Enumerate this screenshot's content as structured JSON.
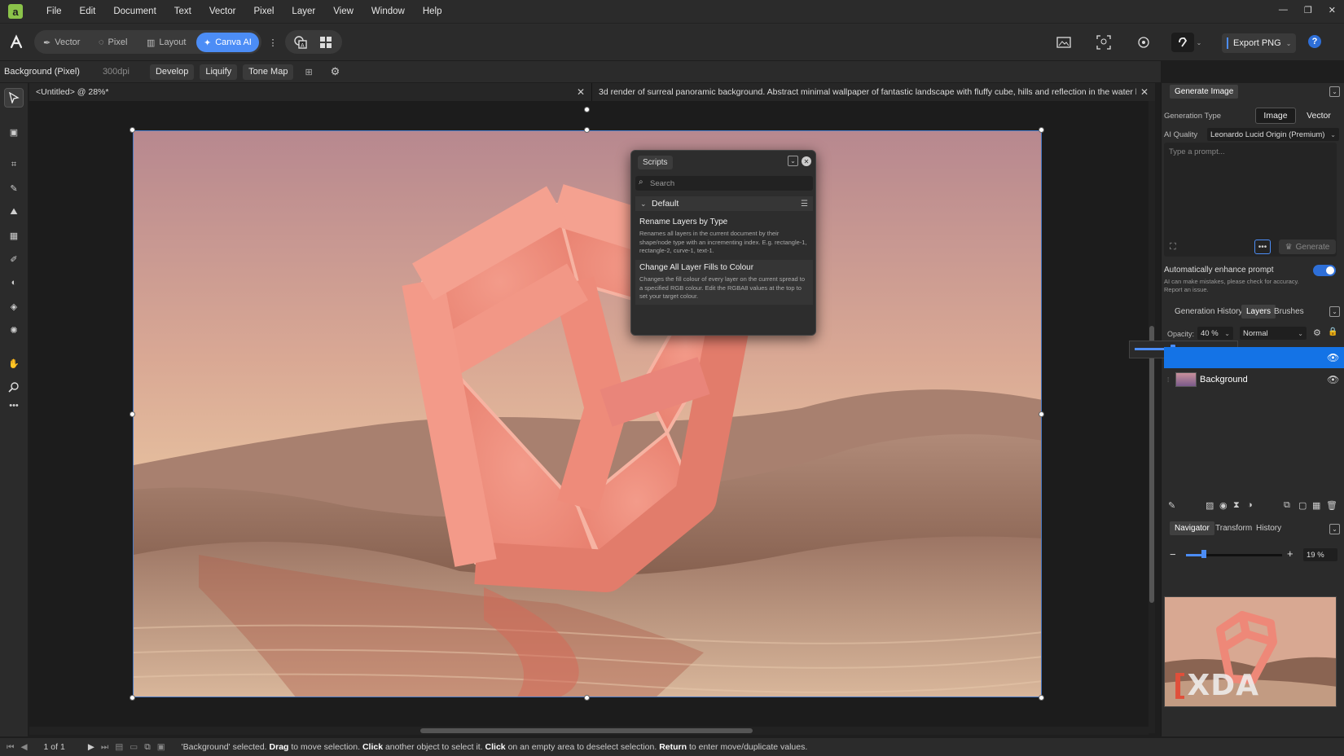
{
  "app": {
    "logo": "a",
    "menu": [
      "File",
      "Edit",
      "Document",
      "Text",
      "Vector",
      "Pixel",
      "Layer",
      "View",
      "Window",
      "Help"
    ],
    "window_controls": [
      "—",
      "❐",
      "✕"
    ]
  },
  "toolbar": {
    "personas": [
      {
        "label": "Vector",
        "icon": "pen-nib-icon",
        "active": false
      },
      {
        "label": "Pixel",
        "icon": "pixel-brush-icon",
        "active": false
      },
      {
        "label": "Layout",
        "icon": "layout-icon",
        "active": false
      },
      {
        "label": "Canva AI",
        "icon": "sparkle-icon",
        "active": true
      }
    ],
    "export_label": "Export PNG",
    "help_label": "?"
  },
  "context_bar": {
    "layer_label": "Background (Pixel)",
    "dpi": "300dpi",
    "buttons": [
      "Develop",
      "Liquify",
      "Tone Map"
    ]
  },
  "documents": {
    "tab1": "<Untitled> @ 28%*",
    "tab2": "3d render of surreal panoramic background. Abstract minimal wallpaper of fantastic landscape with fluffy cube, hills and reflection in the water by Михаил Бо..."
  },
  "scripts_panel": {
    "title": "Scripts",
    "search_placeholder": "Search",
    "group": "Default",
    "items": [
      {
        "name": "Rename Layers by Type",
        "description": "Renames all layers in the current document by their shape/node type with an incrementing index. E.g. rectangle-1, rectangle-2, curve-1, text-1."
      },
      {
        "name": "Change All Layer Fills to Colour",
        "description": "Changes the fill colour of every layer on the current spread to a specified RGB colour. Edit the RGBA8 values at the top to set your target colour."
      }
    ]
  },
  "generate_panel": {
    "tab": "Generate Image",
    "generation_type_label": "Generation Type",
    "type_options": [
      "Image",
      "Vector"
    ],
    "selected_type": "Image",
    "ai_quality_label": "AI Quality",
    "ai_quality_value": "Leonardo Lucid Origin (Premium)",
    "prompt_placeholder": "Type a prompt...",
    "generate_label": "Generate",
    "enhance_label": "Automatically enhance prompt",
    "enhance_on": true,
    "disclaimer": "AI can make mistakes, please check for accuracy.",
    "report": "Report an issue."
  },
  "layers_panel": {
    "tabs": [
      "Generation History",
      "Layers",
      "Brushes"
    ],
    "active_tab": "Layers",
    "opacity_label": "Opacity:",
    "opacity_value": "40 %",
    "opacity_fraction": 0.4,
    "blend_mode": "Normal",
    "layers": [
      {
        "name": "",
        "selected": true
      },
      {
        "name": "Background",
        "selected": false
      }
    ]
  },
  "navigator_panel": {
    "tabs": [
      "Navigator",
      "Transform",
      "History"
    ],
    "active_tab": "Navigator",
    "zoom": "19 %",
    "zoom_fraction": 0.19
  },
  "status_bar": {
    "page": "1 of 1",
    "message_parts": [
      "'Background' selected. ",
      "Drag",
      " to move selection. ",
      "Click",
      " another object to select it. ",
      "Click",
      " on an empty area to deselect selection. ",
      "Return",
      " to enter move/duplicate values."
    ]
  },
  "watermark": "XDA",
  "colors": {
    "accent": "#4c8df6",
    "selection": "#1473e6",
    "logo": "#8bc34a"
  }
}
